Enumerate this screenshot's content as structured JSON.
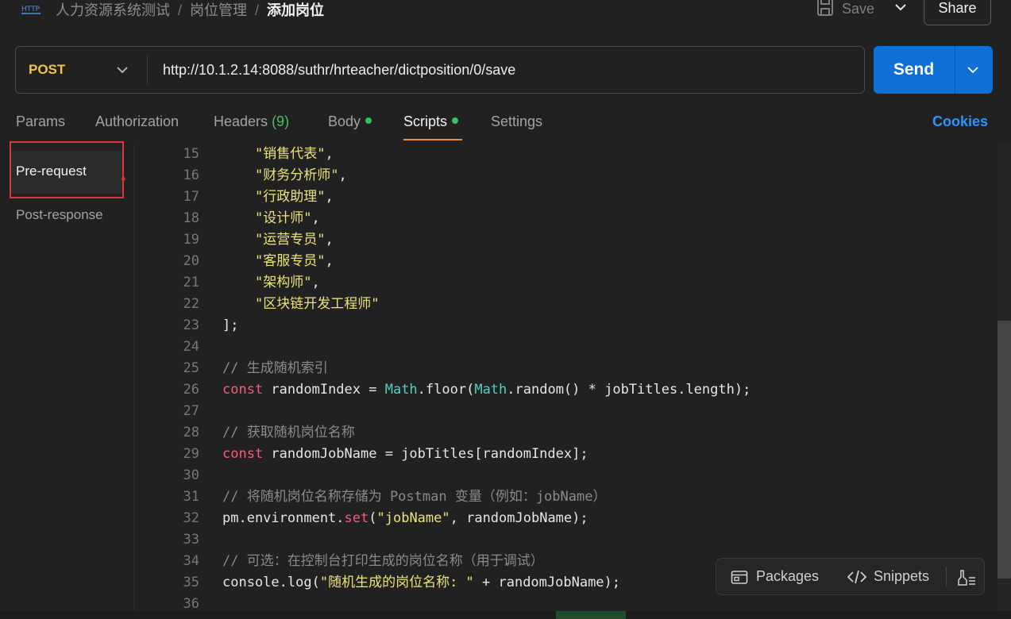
{
  "header": {
    "breadcrumb": [
      "人力资源系统测试",
      "岗位管理",
      "添加岗位"
    ],
    "breadcrumb_separator": "/",
    "save_label": "Save",
    "share_label": "Share",
    "protocol_icon_text": "HTTP"
  },
  "request": {
    "method": "POST",
    "url": "http://10.1.2.14:8088/suthr/hrteacher/dictposition/0/save",
    "send_label": "Send"
  },
  "tabs": {
    "params": "Params",
    "authorization": "Authorization",
    "headers_label": "Headers",
    "headers_count": "(9)",
    "body": "Body",
    "scripts": "Scripts",
    "settings": "Settings",
    "active": "Scripts",
    "cookies": "Cookies"
  },
  "scripts_sidebar": {
    "pre_request": "Pre-request",
    "post_response": "Post-response",
    "active": "Pre-request"
  },
  "code_lines": [
    {
      "n": "15",
      "text": "    \"销售代表\","
    },
    {
      "n": "16",
      "text": "    \"财务分析师\","
    },
    {
      "n": "17",
      "text": "    \"行政助理\","
    },
    {
      "n": "18",
      "text": "    \"设计师\","
    },
    {
      "n": "19",
      "text": "    \"运营专员\","
    },
    {
      "n": "20",
      "text": "    \"客服专员\","
    },
    {
      "n": "21",
      "text": "    \"架构师\","
    },
    {
      "n": "22",
      "text": "    \"区块链开发工程师\""
    },
    {
      "n": "23",
      "text": "];"
    },
    {
      "n": "24",
      "text": ""
    },
    {
      "n": "25",
      "text": "// 生成随机索引"
    },
    {
      "n": "26",
      "text": "const randomIndex = Math.floor(Math.random() * jobTitles.length);"
    },
    {
      "n": "27",
      "text": ""
    },
    {
      "n": "28",
      "text": "// 获取随机岗位名称"
    },
    {
      "n": "29",
      "text": "const randomJobName = jobTitles[randomIndex];"
    },
    {
      "n": "30",
      "text": ""
    },
    {
      "n": "31",
      "text": "// 将随机岗位名称存储为 Postman 变量（例如：jobName）"
    },
    {
      "n": "32",
      "text": "pm.environment.set(\"jobName\", randomJobName);"
    },
    {
      "n": "33",
      "text": ""
    },
    {
      "n": "34",
      "text": "// 可选：在控制台打印生成的岗位名称（用于调试）"
    },
    {
      "n": "35",
      "text": "console.log(\"随机生成的岗位名称: \" + randomJobName);"
    },
    {
      "n": "36",
      "text": ""
    }
  ],
  "toolbox": {
    "packages": "Packages",
    "snippets": "Snippets"
  },
  "colors": {
    "background": "#212121",
    "accent_blue": "#0e6fd6",
    "method_yellow": "#f7c24a",
    "string_yellow": "#ece27a",
    "keyword_pink": "#f45b7c",
    "builtin_teal": "#4fd1c5",
    "tab_underline_orange": "#f28e3a",
    "status_dot_green": "#3bc160",
    "highlight_red": "#d73a3a"
  },
  "icons": [
    "http-protocol-icon",
    "save-icon",
    "chevron-down-icon",
    "send-chevron-icon",
    "packages-icon",
    "snippets-icon",
    "clear-console-icon"
  ]
}
